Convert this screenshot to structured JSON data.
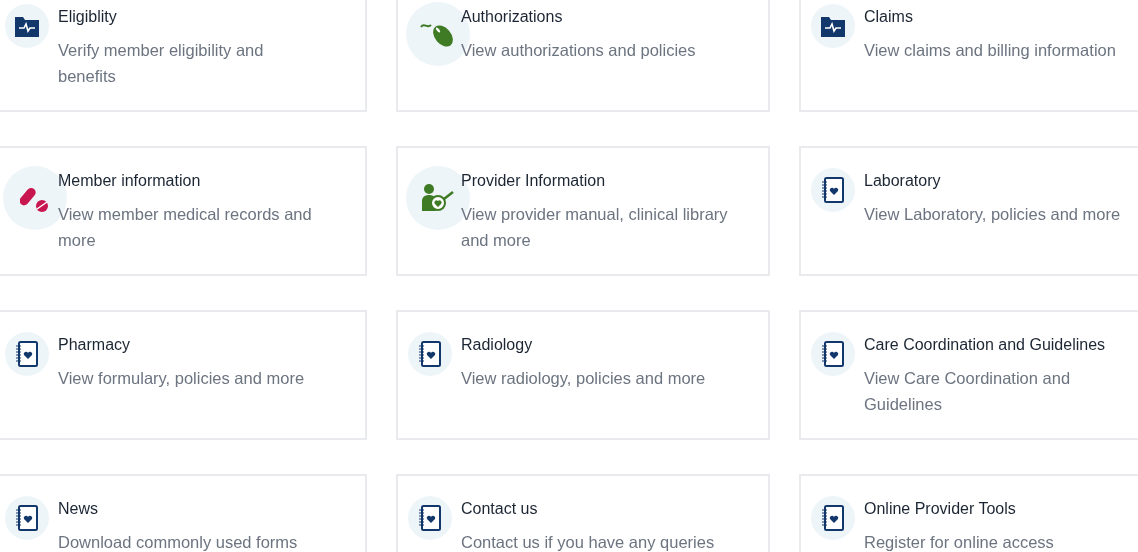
{
  "cards": [
    {
      "title": "Eligiblity",
      "description": "Verify member eligibility and benefits",
      "kind": "pulse-folder"
    },
    {
      "title": "Authorizations",
      "description": "View authorizations and policies",
      "kind": "mouse"
    },
    {
      "title": "Claims",
      "description": "View claims and billing information",
      "kind": "pulse-folder"
    },
    {
      "title": "Member information",
      "description": "View member medical records and more",
      "kind": "pills"
    },
    {
      "title": "Provider Information",
      "description": "View provider manual, clinical library and more",
      "kind": "provider"
    },
    {
      "title": "Laboratory",
      "description": "View Laboratory, policies and more",
      "kind": "notebook"
    },
    {
      "title": "Pharmacy",
      "description": "View formulary, policies and more",
      "kind": "notebook"
    },
    {
      "title": "Radiology",
      "description": "View radiology, policies and more",
      "kind": "notebook"
    },
    {
      "title": "Care Coordination and Guidelines",
      "description": "View Care Coordination and Guidelines",
      "kind": "notebook"
    },
    {
      "title": "News",
      "description": "Download commonly used forms",
      "kind": "notebook"
    },
    {
      "title": "Contact us",
      "description": "Contact us if you have any queries",
      "kind": "notebook"
    },
    {
      "title": "Online Provider Tools",
      "description": "Register for online access",
      "kind": "notebook"
    }
  ]
}
